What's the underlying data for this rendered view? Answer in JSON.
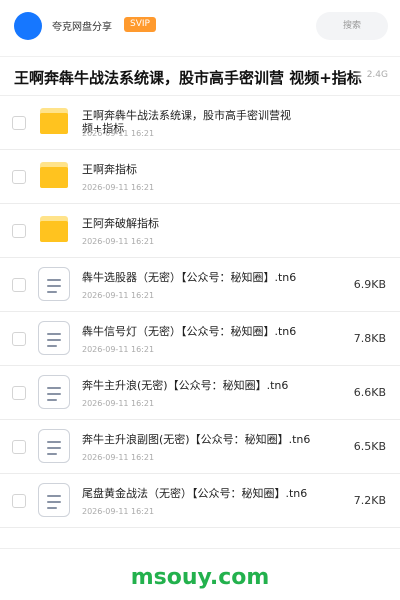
{
  "header": {
    "sharer_name": "夸克网盘分享",
    "badge": "SVIP",
    "search_label": "搜索"
  },
  "title_bar": {
    "title": "王啊奔犇牛战法系统课，股市高手密训营 视频+指标",
    "size": "2.4G"
  },
  "files": [
    {
      "type": "folder",
      "name": "王啊奔犇牛战法系统课，股市高手密训营视频+指标",
      "date": "2026-09-11 16:21",
      "size": ""
    },
    {
      "type": "folder",
      "name": "王啊奔指标",
      "date": "2026-09-11 16:21",
      "size": ""
    },
    {
      "type": "folder",
      "name": "王阿奔破解指标",
      "date": "2026-09-11 16:21",
      "size": ""
    },
    {
      "type": "file",
      "name": "犇牛选股器（无密）【公众号：秘知圈】.tn6",
      "date": "2026-09-11 16:21",
      "size": "6.9KB"
    },
    {
      "type": "file",
      "name": "犇牛信号灯（无密）【公众号：秘知圈】.tn6",
      "date": "2026-09-11 16:21",
      "size": "7.8KB"
    },
    {
      "type": "file",
      "name": "奔牛主升浪(无密)【公众号：秘知圈】.tn6",
      "date": "2026-09-11 16:21",
      "size": "6.6KB"
    },
    {
      "type": "file",
      "name": "奔牛主升浪副图(无密)【公众号：秘知圈】.tn6",
      "date": "2026-09-11 16:21",
      "size": "6.5KB"
    },
    {
      "type": "file",
      "name": "尾盘黄金战法（无密）【公众号：秘知圈】.tn6",
      "date": "2026-09-11 16:21",
      "size": "7.2KB"
    }
  ],
  "watermark": "msouy.com",
  "colors": {
    "avatar": "#1677ff",
    "svip_badge": "#ff9a2e",
    "folder": "#ffc31f",
    "watermark": "#23b14d"
  },
  "icons": {
    "folder": "folder-icon",
    "file": "document-icon"
  }
}
